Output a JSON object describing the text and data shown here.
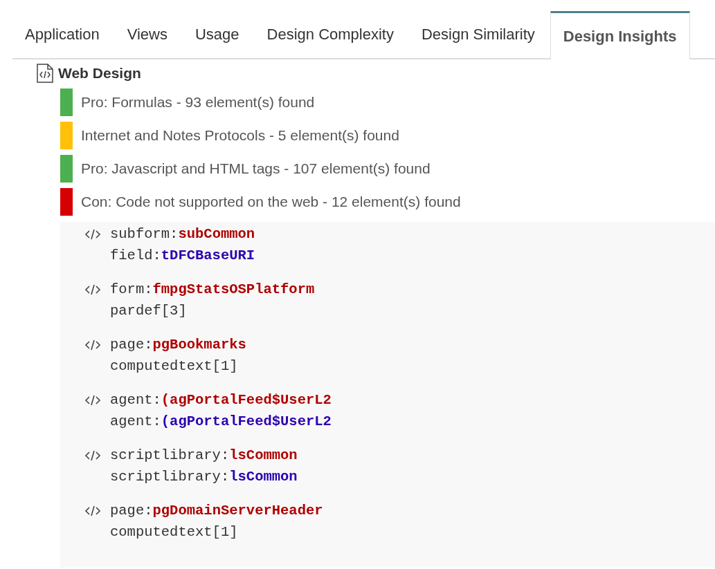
{
  "tabs": [
    {
      "label": "Application",
      "selected": false
    },
    {
      "label": "Views",
      "selected": false
    },
    {
      "label": "Usage",
      "selected": false
    },
    {
      "label": "Design Complexity",
      "selected": false
    },
    {
      "label": "Design Similarity",
      "selected": false
    },
    {
      "label": "Design Insights",
      "selected": true
    }
  ],
  "section": {
    "title": "Web Design",
    "findings": [
      {
        "text": "Pro: Formulas - 93 element(s) found",
        "color": "#4caf50"
      },
      {
        "text": "Internet and Notes Protocols - 5 element(s) found",
        "color": "#ffc107"
      },
      {
        "text": "Pro: Javascript and HTML tags - 107 element(s) found",
        "color": "#4caf50"
      },
      {
        "text": "Con: Code not supported on the web - 12 element(s) found",
        "color": "#d50000"
      }
    ],
    "code_entries": [
      {
        "element": {
          "type": "subform:",
          "name": "subCommon"
        },
        "target": {
          "type": "field:",
          "name": "tDFCBaseURI"
        }
      },
      {
        "element": {
          "type": "form:",
          "name": "fmpgStatsOSPlatform"
        },
        "target": {
          "type": "pardef[3]"
        }
      },
      {
        "element": {
          "type": "page:",
          "name": "pgBookmarks"
        },
        "target": {
          "type": "computedtext[1]"
        }
      },
      {
        "element": {
          "type": "agent:",
          "name": "(agPortalFeed$UserL2"
        },
        "target": {
          "type": "agent:",
          "name": "(agPortalFeed$UserL2"
        }
      },
      {
        "element": {
          "type": "scriptlibrary:",
          "name": "lsCommon"
        },
        "target": {
          "type": "scriptlibrary:",
          "name": "lsCommon"
        }
      },
      {
        "element": {
          "type": "page:",
          "name": "pgDomainServerHeader"
        },
        "target": {
          "type": "computedtext[1]"
        }
      }
    ]
  }
}
